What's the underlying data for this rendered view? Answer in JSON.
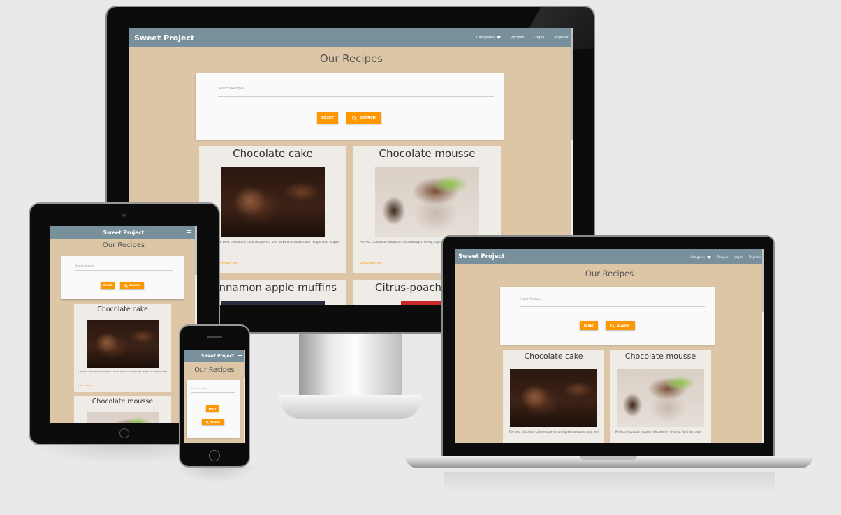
{
  "site": {
    "brand": "Sweet Project",
    "nav": {
      "categories": "Categories",
      "recipes": "Recipes",
      "login": "Log In",
      "register": "Register"
    },
    "page_title": "Our Recipes",
    "search": {
      "placeholder": "Search Recipes",
      "reset": "RESET",
      "search": "SEARCH"
    },
    "link_label": "VIEW RECIPE",
    "recipes": [
      {
        "title": "Chocolate cake",
        "desc": "The best chocolate cake recipe « a one bowl chocolate cake recipe that is quick, easy, and delicious",
        "image": "chocolate-cake"
      },
      {
        "title": "Chocolate mousse",
        "desc": "Perfect chocolate mousse! decadently creamy, light and airy",
        "image": "chocolate-mousse"
      },
      {
        "title": "Cinnamon apple muffins",
        "desc": "",
        "image": "muffins"
      },
      {
        "title": "Citrus-poached pears",
        "desc": "",
        "image": "pears"
      }
    ]
  },
  "colors": {
    "navbar": "#78909c",
    "page_bg": "#dcc6a6",
    "accent": "#ff9800",
    "card_bg": "#efebe7"
  },
  "icons": {
    "search": "search-icon",
    "menu": "hamburger-menu-icon",
    "dropdown": "caret-down-icon"
  }
}
